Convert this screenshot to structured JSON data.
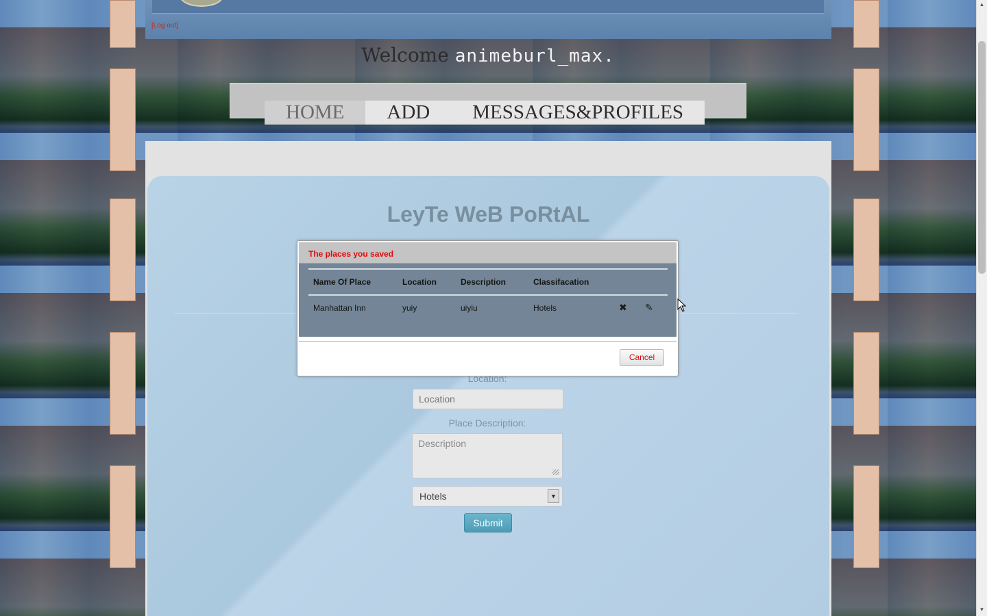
{
  "header": {
    "logout_label": "[Log out]",
    "welcome_prefix": "Welcome",
    "username": "animeburl_max."
  },
  "nav": {
    "items": [
      {
        "label": "HOME",
        "active": true
      },
      {
        "label": "ADD",
        "active": false
      },
      {
        "label": "MESSAGES&PROFILES",
        "active": false
      }
    ]
  },
  "main": {
    "title": "LeyTe WeB PoRtAL",
    "form": {
      "location_label": "Location:",
      "location_placeholder": "Location",
      "description_label": "Place Description:",
      "description_placeholder": "Description",
      "classification_selected": "Hotels",
      "submit_label": "Submit"
    }
  },
  "modal": {
    "title": "The places you saved",
    "columns": [
      "Name Of Place",
      "Location",
      "Description",
      "Classifacation"
    ],
    "rows": [
      {
        "name": "Manhattan Inn",
        "location": "yuiy",
        "description": "uiyiu",
        "classification": "Hotels"
      }
    ],
    "cancel_label": "Cancel"
  },
  "icons": {
    "delete": "close-icon",
    "edit": "pencil-icon"
  },
  "colors": {
    "modal_title": "#e00b0b",
    "cancel_text": "#d40d0d",
    "modal_body": "#738597",
    "submit_bg": "#5aa8c0"
  }
}
